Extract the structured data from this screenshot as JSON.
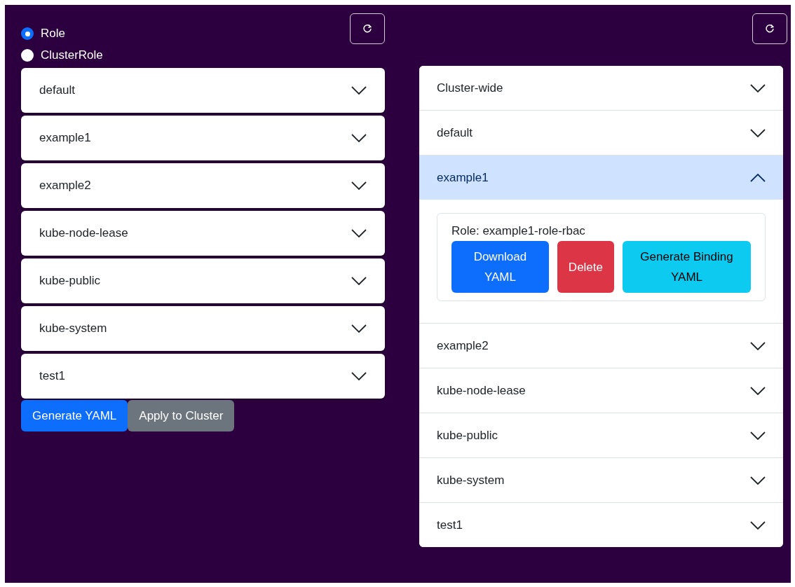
{
  "role_type": [
    {
      "label": "Role",
      "selected": true
    },
    {
      "label": "ClusterRole",
      "selected": false
    }
  ],
  "left_namespaces": [
    {
      "label": "default",
      "expanded": false
    },
    {
      "label": "example1",
      "expanded": false
    },
    {
      "label": "example2",
      "expanded": false
    },
    {
      "label": "kube-node-lease",
      "expanded": false
    },
    {
      "label": "kube-public",
      "expanded": false
    },
    {
      "label": "kube-system",
      "expanded": false
    },
    {
      "label": "test1",
      "expanded": false
    }
  ],
  "left_actions": [
    {
      "label": "Generate YAML",
      "kind": "primary"
    },
    {
      "label": "Apply to Cluster",
      "kind": "secondary"
    }
  ],
  "right_namespaces": [
    {
      "label": "Cluster-wide",
      "expanded": false
    },
    {
      "label": "default",
      "expanded": false
    },
    {
      "label": "example1",
      "expanded": true,
      "roles": [
        {
          "title": "Role: example1-role-rbac",
          "actions": [
            {
              "label": "Download YAML",
              "kind": "primary"
            },
            {
              "label": "Delete",
              "kind": "danger"
            },
            {
              "label": "Generate Binding YAML",
              "kind": "info"
            }
          ]
        }
      ]
    },
    {
      "label": "example2",
      "expanded": false
    },
    {
      "label": "kube-node-lease",
      "expanded": false
    },
    {
      "label": "kube-public",
      "expanded": false
    },
    {
      "label": "kube-system",
      "expanded": false
    },
    {
      "label": "test1",
      "expanded": false
    }
  ]
}
